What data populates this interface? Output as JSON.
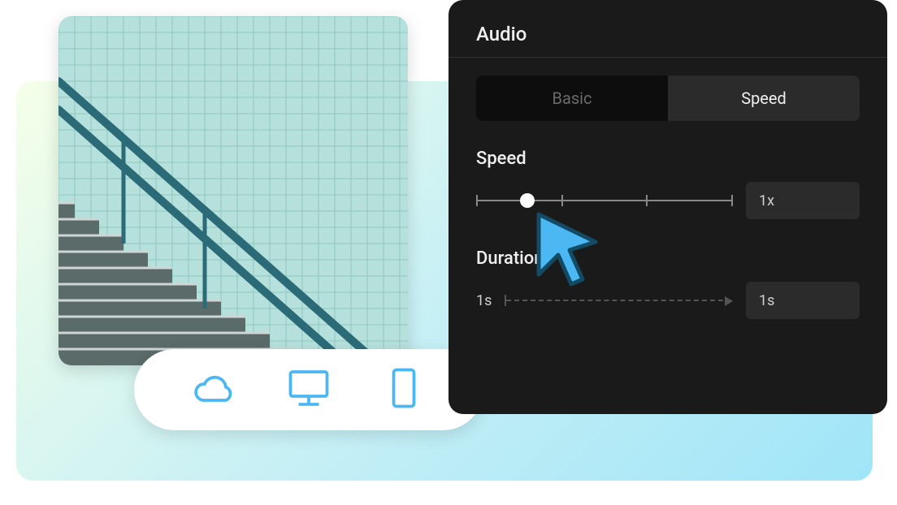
{
  "panel": {
    "title": "Audio",
    "tabs": {
      "basic": "Basic",
      "speed": "Speed"
    },
    "speed": {
      "label": "Speed",
      "value": "1x",
      "slider_position_pct": 20
    },
    "duration": {
      "label": "Duration",
      "start": "1s",
      "end": "1s"
    }
  },
  "device_icons": [
    "cloud",
    "monitor",
    "phone"
  ],
  "colors": {
    "accent": "#4bb8f4",
    "panel_bg": "#1a1a1a"
  }
}
